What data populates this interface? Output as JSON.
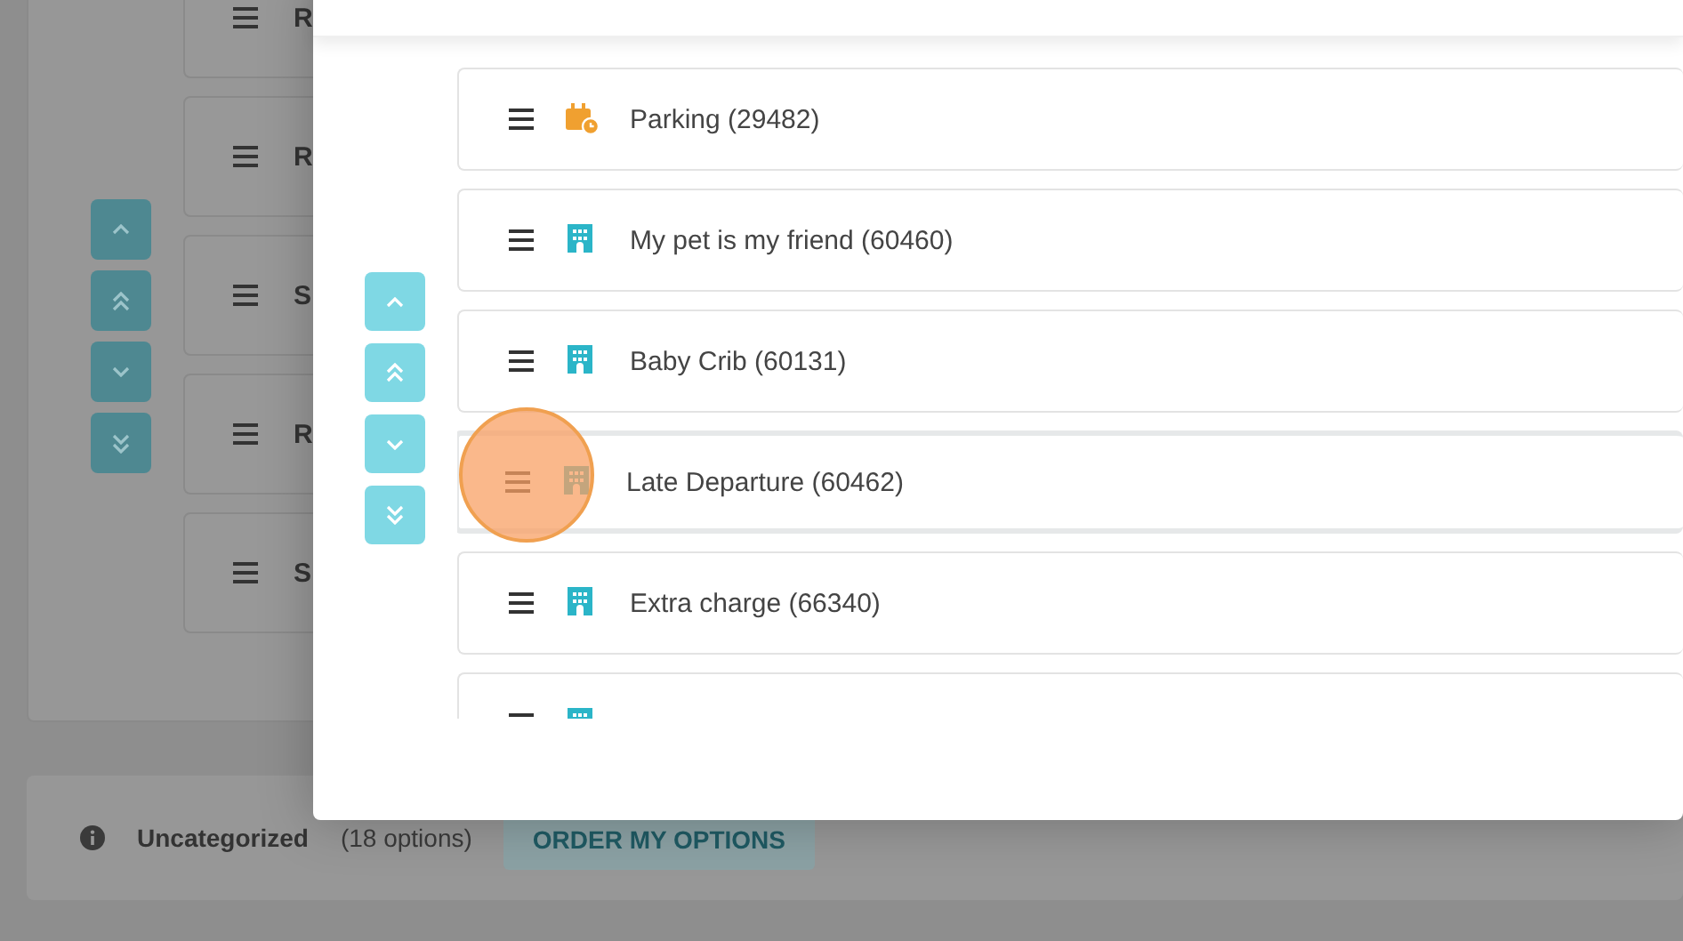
{
  "background": {
    "rows": [
      {
        "label": "R"
      },
      {
        "label": "R"
      },
      {
        "label": "S"
      },
      {
        "label": "R"
      },
      {
        "label": "S"
      }
    ],
    "move_buttons": [
      {
        "kind": "up"
      },
      {
        "kind": "top"
      },
      {
        "kind": "down"
      },
      {
        "kind": "bottom"
      }
    ],
    "category": {
      "title": "Uncategorized",
      "count": "(18 options)",
      "button": "ORDER MY OPTIONS"
    }
  },
  "dialog": {
    "move_buttons": [
      {
        "kind": "up"
      },
      {
        "kind": "top"
      },
      {
        "kind": "down"
      },
      {
        "kind": "bottom"
      }
    ],
    "options": [
      {
        "label": "Parking (29482)",
        "kind": "calendar",
        "dragging": false
      },
      {
        "label": "My pet is my friend (60460)",
        "kind": "building",
        "dragging": false
      },
      {
        "label": "Baby Crib (60131)",
        "kind": "building",
        "dragging": false
      },
      {
        "label": "Late Departure (60462)",
        "kind": "building",
        "dragging": true
      },
      {
        "label": "Extra charge (66340)",
        "kind": "building",
        "dragging": false
      },
      {
        "kind": "building",
        "dragging": false
      }
    ]
  }
}
